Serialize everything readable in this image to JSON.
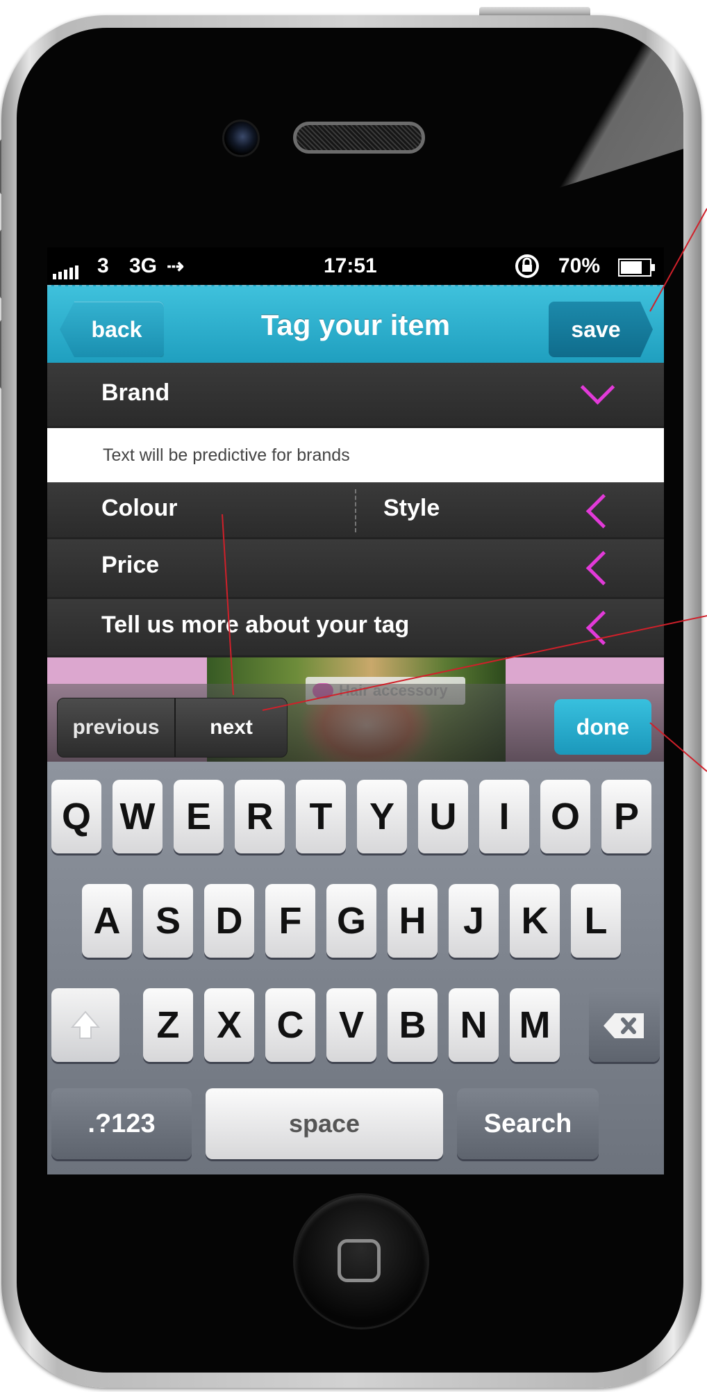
{
  "status_bar": {
    "signal": "3",
    "network": "3G",
    "time": "17:51",
    "battery": "70%"
  },
  "nav_bar": {
    "back_label": "back",
    "title": "Tag your item",
    "save_label": "save"
  },
  "form": {
    "brand_label": "Brand",
    "brand_placeholder": "Text will be predictive for brands",
    "colour_label": "Colour",
    "style_label": "Style",
    "price_label": "Price",
    "more_label": "Tell us more about your tag"
  },
  "photo": {
    "tag_label": "Hair accessory"
  },
  "toolbar": {
    "previous_label": "previous",
    "next_label": "next",
    "done_label": "done"
  },
  "keyboard": {
    "row1": [
      "Q",
      "W",
      "E",
      "R",
      "T",
      "Y",
      "U",
      "I",
      "O",
      "P"
    ],
    "row2": [
      "A",
      "S",
      "D",
      "F",
      "G",
      "H",
      "J",
      "K",
      "L"
    ],
    "row3": [
      "Z",
      "X",
      "C",
      "V",
      "B",
      "N",
      "M"
    ],
    "num_label": ".?123",
    "space_label": "space",
    "search_label": "Search"
  },
  "colors": {
    "accent": "#2aa9cb",
    "chevron": "#e23ad8",
    "annotation": "#d0202a"
  }
}
